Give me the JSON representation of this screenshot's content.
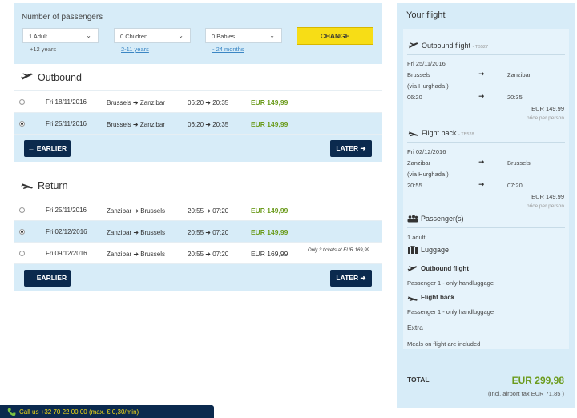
{
  "passengers": {
    "title": "Number of passengers",
    "adult": {
      "value": "1 Adult",
      "hint": "+12 years"
    },
    "children": {
      "value": "0 Children",
      "hint": "2-11 years"
    },
    "babies": {
      "value": "0 Babies",
      "hint": "- 24 months"
    },
    "change_label": "CHANGE"
  },
  "outbound": {
    "title": "Outbound",
    "rows": [
      {
        "date": "Fri 18/11/2016",
        "from": "Brussels",
        "to": "Zanzibar",
        "dep": "06:20",
        "arr": "20:35",
        "price": "EUR 149,99",
        "selected": false
      },
      {
        "date": "Fri 25/11/2016",
        "from": "Brussels",
        "to": "Zanzibar",
        "dep": "06:20",
        "arr": "20:35",
        "price": "EUR 149,99",
        "selected": true
      }
    ],
    "earlier_label": "EARLIER",
    "later_label": "LATER"
  },
  "return": {
    "title": "Return",
    "rows": [
      {
        "date": "Fri 25/11/2016",
        "from": "Zanzibar",
        "to": "Brussels",
        "dep": "20:55",
        "arr": "07:20",
        "price": "EUR 149,99",
        "selected": false,
        "note": ""
      },
      {
        "date": "Fri 02/12/2016",
        "from": "Zanzibar",
        "to": "Brussels",
        "dep": "20:55",
        "arr": "07:20",
        "price": "EUR 149,99",
        "selected": true,
        "note": ""
      },
      {
        "date": "Fri 09/12/2016",
        "from": "Zanzibar",
        "to": "Brussels",
        "dep": "20:55",
        "arr": "07:20",
        "price": "EUR 169,99",
        "selected": false,
        "note": "Only 3 tickets at EUR 169,99"
      }
    ],
    "earlier_label": "EARLIER",
    "later_label": "LATER"
  },
  "summary": {
    "title": "Your flight",
    "outbound": {
      "heading": "Outbound flight",
      "code": "- TB527",
      "date": "Fri 25/11/2016",
      "from": "Brussels",
      "to": "Zanzibar",
      "via": "(via Hurghada )",
      "dep": "06:20",
      "arr": "20:35",
      "price": "EUR 149,99",
      "price_note": "price per person"
    },
    "back": {
      "heading": "Flight back",
      "code": "- TB528",
      "date": "Fri 02/12/2016",
      "from": "Zanzibar",
      "to": "Brussels",
      "via": "(via Hurghada )",
      "dep": "20:55",
      "arr": "07:20",
      "price": "EUR 149,99",
      "price_note": "price per person"
    },
    "passengers_heading": "Passenger(s)",
    "passengers_value": "1 adult",
    "luggage_heading": "Luggage",
    "luggage_outbound_heading": "Outbound flight",
    "luggage_outbound_value": "Passenger 1 - only handluggage",
    "luggage_back_heading": "Flight back",
    "luggage_back_value": "Passenger 1 - only handluggage",
    "extra_heading": "Extra",
    "extra_value": "Meals on flight are included",
    "total_label": "TOTAL",
    "total_value": "EUR 299,98",
    "total_tax": "(Incl. airport tax EUR 71,85 )"
  },
  "call_bar": {
    "text": "Call us +32 70 22 00 00 (max. € 0,30/min)"
  },
  "colors": {
    "accent_yellow": "#f7dd16",
    "navy": "#0b2a4e",
    "light_blue": "#d7ecf8",
    "price_green": "#6b9b1c"
  }
}
